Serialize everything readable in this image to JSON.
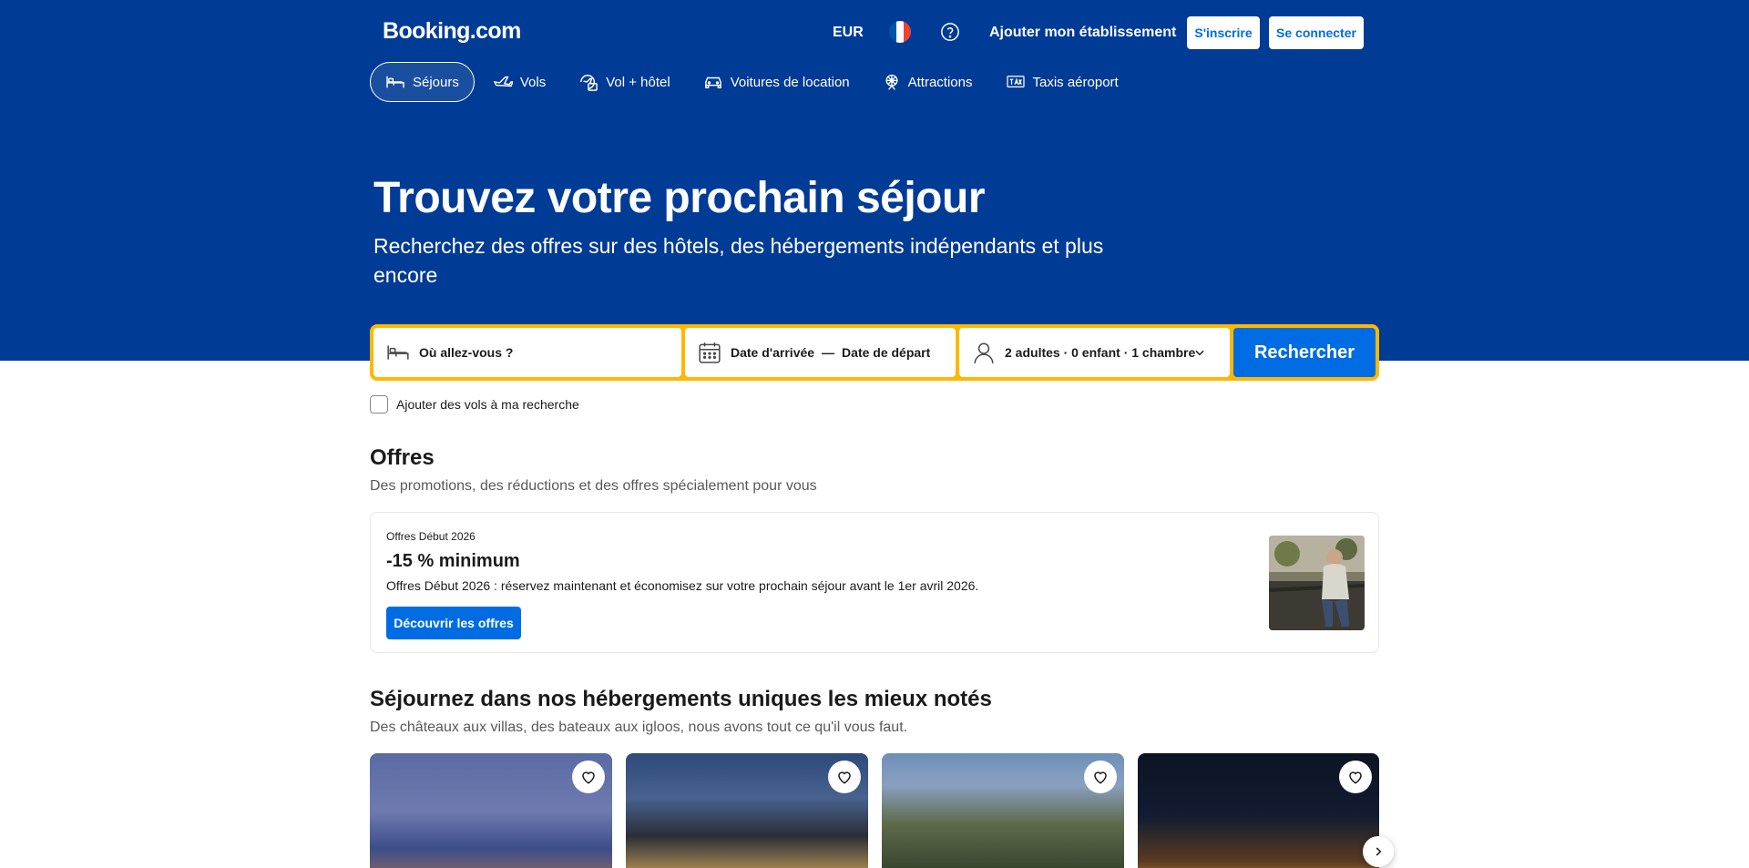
{
  "header": {
    "logo": "Booking.com",
    "currency": "EUR",
    "add_property": "Ajouter mon établissement",
    "signup": "S'inscrire",
    "login": "Se connecter"
  },
  "nav": [
    {
      "label": "Séjours",
      "icon": "bed-icon",
      "active": true
    },
    {
      "label": "Vols",
      "icon": "plane-icon"
    },
    {
      "label": "Vol + hôtel",
      "icon": "flight-hotel-icon"
    },
    {
      "label": "Voitures de location",
      "icon": "car-icon"
    },
    {
      "label": "Attractions",
      "icon": "attractions-icon"
    },
    {
      "label": "Taxis aéroport",
      "icon": "taxi-icon"
    }
  ],
  "hero": {
    "title": "Trouvez votre prochain séjour",
    "subtitle": "Recherchez des offres sur des hôtels, des hébergements indépendants et plus encore"
  },
  "search": {
    "destination": "Où allez-vous ?",
    "checkin": "Date d'arrivée",
    "dash": "—",
    "checkout": "Date de départ",
    "guests": "2 adultes · 0 enfant · 1 chambre",
    "submit": "Rechercher",
    "add_flights": "Ajouter des vols à ma recherche"
  },
  "offers": {
    "title": "Offres",
    "subtitle": "Des promotions, des réductions et des offres spécialement pour vous",
    "card": {
      "kicker": "Offres Début 2026",
      "headline": "-15 % minimum",
      "text": "Offres Début 2026 : réservez maintenant et économisez sur votre prochain séjour avant le 1er avril 2026.",
      "button": "Découvrir les offres"
    }
  },
  "unique": {
    "title": "Séjournez dans nos hébergements uniques les mieux notés",
    "subtitle": "Des châteaux aux villas, des bateaux aux igloos, nous avons tout ce qu'il vous faut."
  },
  "colors": {
    "brand_blue": "#003b95",
    "action_blue": "#006ce4",
    "search_border": "#ffb700"
  }
}
